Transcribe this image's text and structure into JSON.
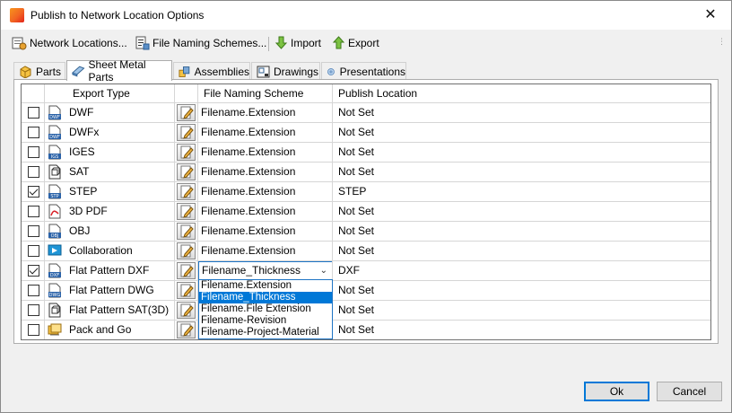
{
  "window": {
    "title": "Publish to Network Location Options",
    "close_glyph": "✕"
  },
  "toolbar": {
    "network_locations": "Network Locations...",
    "file_naming": "File Naming Schemes...",
    "import": "Import",
    "export": "Export"
  },
  "tabs": [
    "Parts",
    "Sheet Metal Parts",
    "Assemblies",
    "Drawings",
    "Presentations"
  ],
  "active_tab": "Sheet Metal Parts",
  "table": {
    "headers": {
      "export_type": "Export Type",
      "naming": "File Naming Scheme",
      "location": "Publish Location"
    },
    "rows": [
      {
        "checked": false,
        "type": "DWF",
        "icon": "dwf-file-icon",
        "naming": "Filename.Extension",
        "location": "Not  Set"
      },
      {
        "checked": false,
        "type": "DWFx",
        "icon": "dwfx-file-icon",
        "naming": "Filename.Extension",
        "location": "Not  Set"
      },
      {
        "checked": false,
        "type": "IGES",
        "icon": "iges-file-icon",
        "naming": "Filename.Extension",
        "location": "Not  Set"
      },
      {
        "checked": false,
        "type": "SAT",
        "icon": "sat-file-icon",
        "naming": "Filename.Extension",
        "location": "Not  Set"
      },
      {
        "checked": true,
        "type": "STEP",
        "icon": "step-file-icon",
        "naming": "Filename.Extension",
        "location": "STEP"
      },
      {
        "checked": false,
        "type": "3D PDF",
        "icon": "pdf-file-icon",
        "naming": "Filename.Extension",
        "location": "Not  Set"
      },
      {
        "checked": false,
        "type": "OBJ",
        "icon": "obj-file-icon",
        "naming": "Filename.Extension",
        "location": "Not  Set"
      },
      {
        "checked": false,
        "type": "Collaboration",
        "icon": "collaboration-icon",
        "naming": "Filename.Extension",
        "location": "Not  Set"
      },
      {
        "checked": true,
        "type": "Flat Pattern DXF",
        "icon": "dxf-file-icon",
        "naming": "Filename_Thickness",
        "location": "DXF"
      },
      {
        "checked": false,
        "type": "Flat Pattern DWG",
        "icon": "dwg-file-icon",
        "naming": "",
        "location": "Not  Set"
      },
      {
        "checked": false,
        "type": "Flat Pattern SAT(3D)",
        "icon": "sat-file-icon",
        "naming": "",
        "location": "Not  Set"
      },
      {
        "checked": false,
        "type": "Pack and Go",
        "icon": "pack-and-go-icon",
        "naming": "",
        "location": "Not  Set"
      }
    ]
  },
  "dropdown": {
    "options": [
      "Filename.Extension",
      "Filename_Thickness",
      "Filename.File Extension",
      "Filename-Revision",
      "Filename-Project-Material"
    ],
    "selected_index": 1
  },
  "buttons": {
    "ok": "Ok",
    "cancel": "Cancel"
  },
  "colors": {
    "accent": "#0078d7",
    "focus_border": "#1e74c5"
  }
}
